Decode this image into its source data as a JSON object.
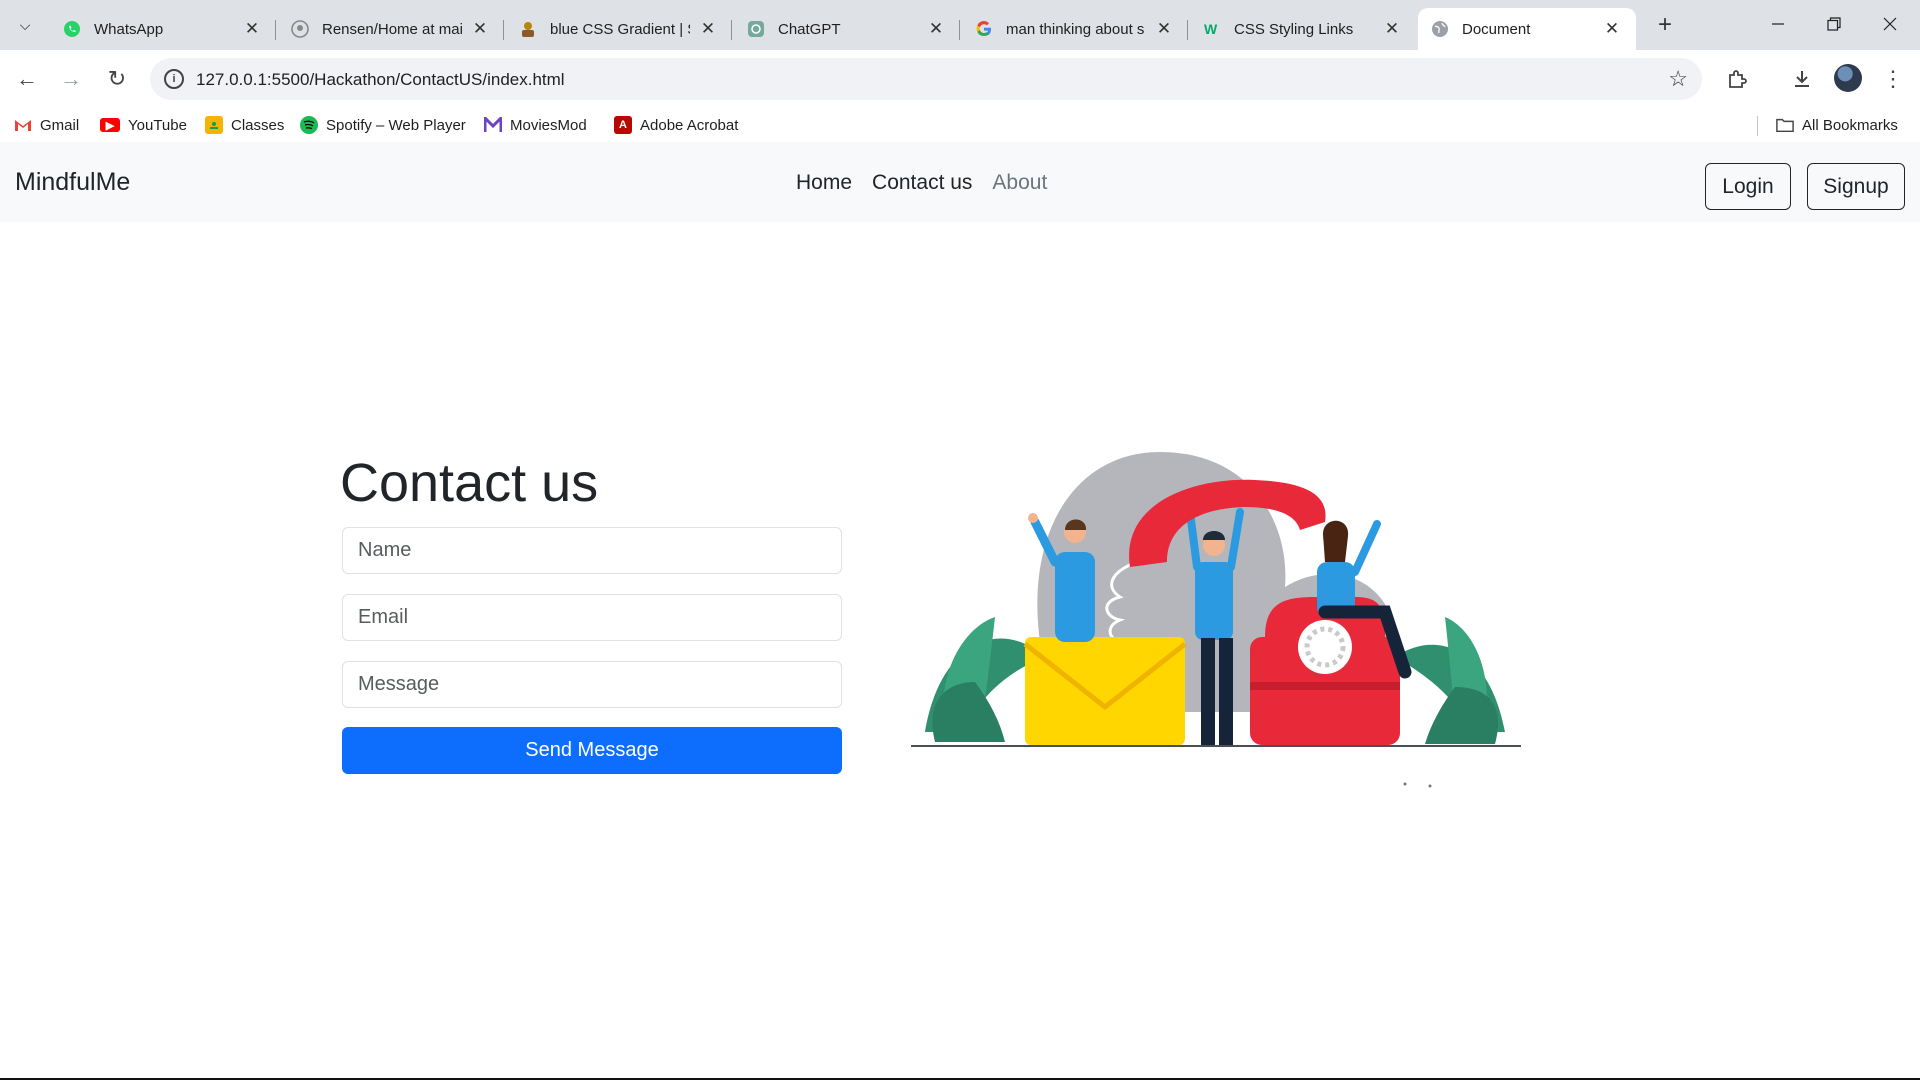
{
  "browser": {
    "tabs": [
      {
        "title": "WhatsApp",
        "icon": "whatsapp-icon"
      },
      {
        "title": "Rensen/Home at mai",
        "icon": "github-icon"
      },
      {
        "title": "blue CSS Gradient | S",
        "icon": "gradient-site-icon"
      },
      {
        "title": "ChatGPT",
        "icon": "chatgpt-icon"
      },
      {
        "title": "man thinking about s",
        "icon": "google-icon"
      },
      {
        "title": "CSS Styling Links",
        "icon": "w3schools-icon"
      },
      {
        "title": "Document",
        "icon": "globe-icon",
        "active": true
      }
    ],
    "url": "127.0.0.1:5500/Hackathon/ContactUS/index.html",
    "bookmarks": [
      {
        "label": "Gmail",
        "icon": "gmail-icon"
      },
      {
        "label": "YouTube",
        "icon": "youtube-icon"
      },
      {
        "label": "Classes",
        "icon": "classroom-icon"
      },
      {
        "label": "Spotify – Web Player",
        "icon": "spotify-icon"
      },
      {
        "label": "MoviesMod",
        "icon": "moviesmod-icon"
      },
      {
        "label": "Adobe Acrobat",
        "icon": "acrobat-icon"
      }
    ],
    "all_bookmarks_label": "All Bookmarks"
  },
  "site": {
    "brand": "MindfulMe",
    "nav": {
      "home": "Home",
      "contact": "Contact us",
      "about": "About"
    },
    "login": "Login",
    "signup": "Signup"
  },
  "contact": {
    "title": "Contact us",
    "name_placeholder": "Name",
    "email_placeholder": "Email",
    "message_placeholder": "Message",
    "send": "Send Message"
  },
  "colors": {
    "primary": "#0d6efd",
    "navbar_bg": "#f8f9fa",
    "envelope": "#ffd600",
    "phone": "#e8293a",
    "leaf": "#2f8f6f",
    "blob": "#b4b6bb"
  }
}
